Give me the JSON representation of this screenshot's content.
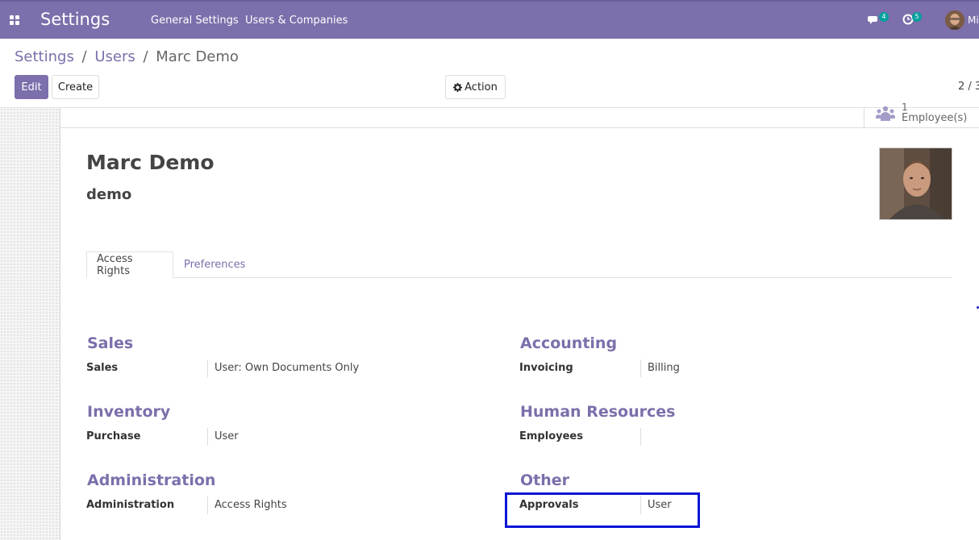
{
  "navbar": {
    "app_title": "Settings",
    "menu": [
      "General Settings",
      "Users & Companies"
    ],
    "messages_count": "4",
    "activities_count": "5",
    "user_name": "Mi"
  },
  "breadcrumb": {
    "items": [
      "Settings",
      "Users",
      "Marc Demo"
    ]
  },
  "toolbar": {
    "edit_label": "Edit",
    "create_label": "Create",
    "action_label": "Action",
    "pager": "2 / 3"
  },
  "stat_button": {
    "count": "1",
    "label": "Employee(s)"
  },
  "user": {
    "name": "Marc Demo",
    "login": "demo"
  },
  "tabs": [
    "Access Rights",
    "Preferences"
  ],
  "groups": {
    "sales": {
      "title": "Sales",
      "label": "Sales",
      "value": "User: Own Documents Only"
    },
    "accounting": {
      "title": "Accounting",
      "label": "Invoicing",
      "value": "Billing"
    },
    "inventory": {
      "title": "Inventory",
      "label": "Purchase",
      "value": "User"
    },
    "hr": {
      "title": "Human Resources",
      "label": "Employees",
      "value": ""
    },
    "administration": {
      "title": "Administration",
      "label": "Administration",
      "value": "Access Rights"
    },
    "other": {
      "title": "Other",
      "label": "Approvals",
      "value": "User"
    }
  },
  "colors": {
    "brand": "#7c6fab",
    "highlight": "#0a16d4"
  }
}
